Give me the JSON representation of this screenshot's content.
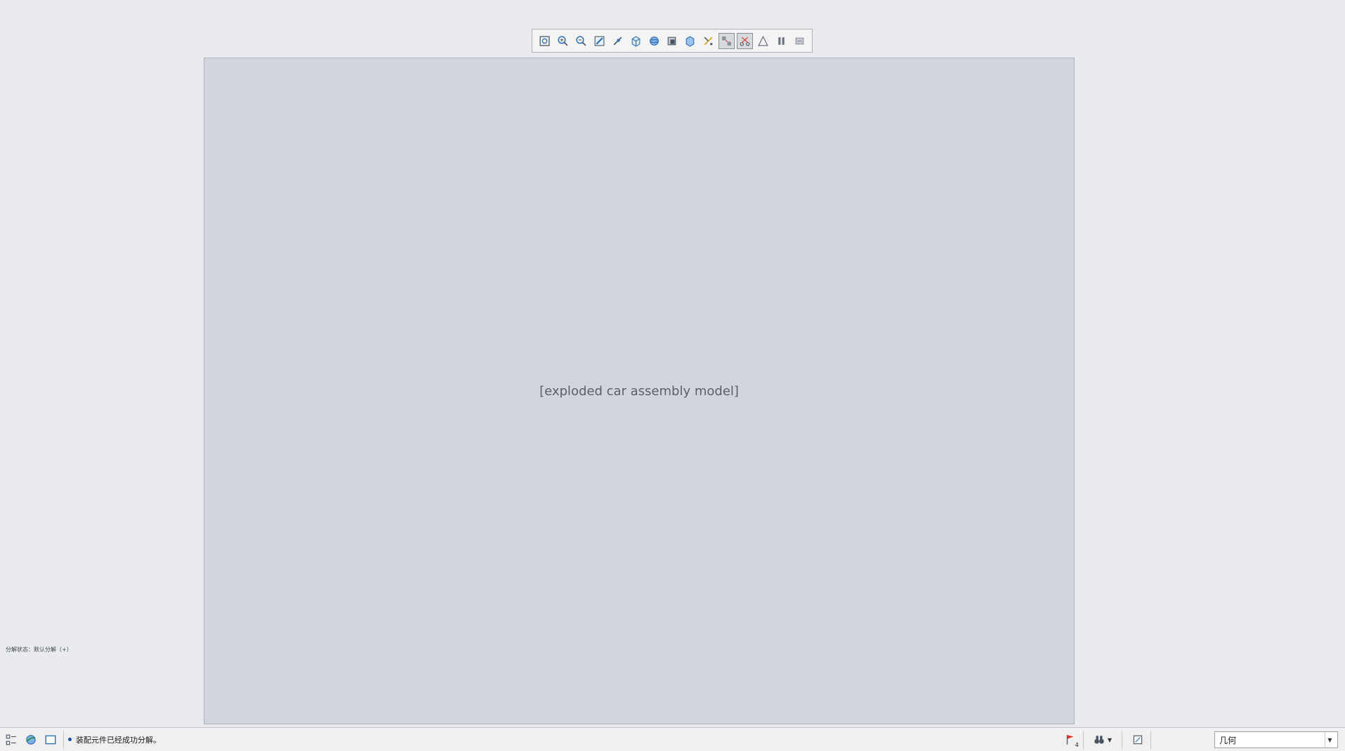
{
  "toolbar": {
    "buttons": [
      {
        "icon": "refit-icon"
      },
      {
        "icon": "zoom-in-icon"
      },
      {
        "icon": "zoom-out-icon"
      },
      {
        "icon": "repaint-icon"
      },
      {
        "icon": "orient-icon"
      },
      {
        "icon": "saved-views-icon"
      },
      {
        "icon": "display-style-icon"
      },
      {
        "icon": "section-icon"
      },
      {
        "icon": "view-manager-icon"
      },
      {
        "icon": "datum-display-icon"
      },
      {
        "icon": "explode-view-icon",
        "active": true
      },
      {
        "icon": "edit-position-icon",
        "active": true
      },
      {
        "icon": "annotations-icon"
      },
      {
        "icon": "pause-icon"
      },
      {
        "icon": "spin-center-icon"
      }
    ]
  },
  "viewport": {
    "placeholder_label": "[exploded car assembly model]",
    "explode_state": "分解状态：默认分解（+）"
  },
  "status_bar": {
    "message": "装配元件已经成功分解。",
    "notification_count": "4",
    "filter_value": "几何",
    "colors": {
      "flag": "#d9362b",
      "bullet": "#1a4fa0"
    }
  }
}
